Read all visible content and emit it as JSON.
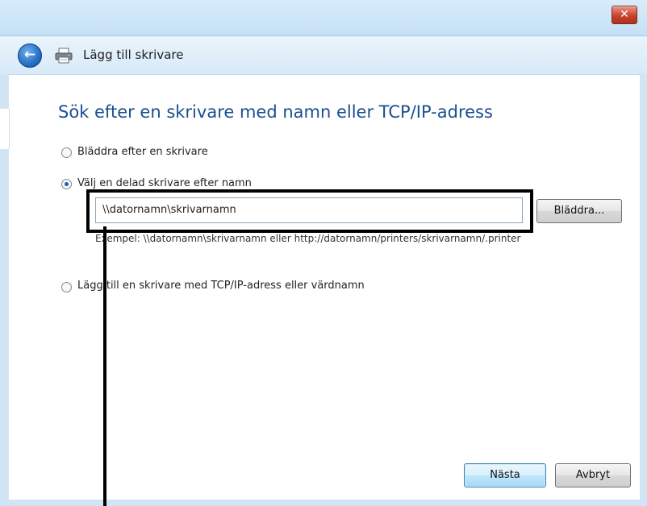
{
  "window": {
    "close_label": "✕"
  },
  "header": {
    "back_icon": "back-arrow-icon",
    "printer_icon": "printer-icon",
    "title": "Lägg till skrivare"
  },
  "main": {
    "heading": "Sök efter en skrivare med namn eller TCP/IP-adress",
    "options": [
      {
        "label": "Bläddra efter en skrivare",
        "selected": false
      },
      {
        "label": "Välj en delad skrivare efter namn",
        "selected": true
      },
      {
        "label": "Lägg till en skrivare med TCP/IP-adress eller värdnamn",
        "selected": false
      }
    ],
    "shared_printer_name_value": "\\\\datornamn\\skrivarnamn",
    "browse_label": "Bläddra...",
    "example_text": "Exempel: \\\\datornamn\\skrivarnamn eller http://datornamn/printers/skrivarnamn/.printer"
  },
  "footer": {
    "next_label": "Nästa",
    "cancel_label": "Avbryt"
  },
  "colors": {
    "heading": "#1a4f8f",
    "highlight_frame": "#000000",
    "close_button": "#c8422c"
  }
}
